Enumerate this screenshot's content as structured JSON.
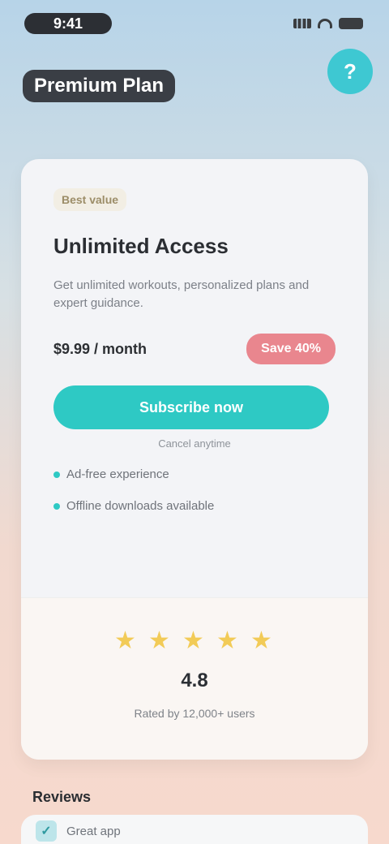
{
  "status": {
    "time": "9:41",
    "icons": [
      "signal-icon",
      "wifi-icon",
      "battery-icon"
    ]
  },
  "header": {
    "title": "Premium Plan",
    "help_label": "?"
  },
  "card": {
    "badge": "Best value",
    "title": "Unlimited Access",
    "description": "Get unlimited workouts, personalized plans and expert guidance.",
    "price": "$9.99 / month",
    "discount_label": "Save 40%",
    "subscribe_label": "Subscribe now",
    "cancel_note": "Cancel anytime",
    "features": [
      "Ad-free experience",
      "Offline downloads available"
    ],
    "rating": {
      "value_text": "4.8",
      "value": 4.8,
      "max": 5,
      "caption": "Rated by 12,000+ users"
    }
  },
  "bottom": {
    "section_title": "Reviews",
    "first_item_text": "Great app"
  },
  "colors": {
    "accent": "#2ec9c4",
    "help_button": "#3ec8d2",
    "discount": "#e9868e",
    "star": "#f2cb57"
  }
}
